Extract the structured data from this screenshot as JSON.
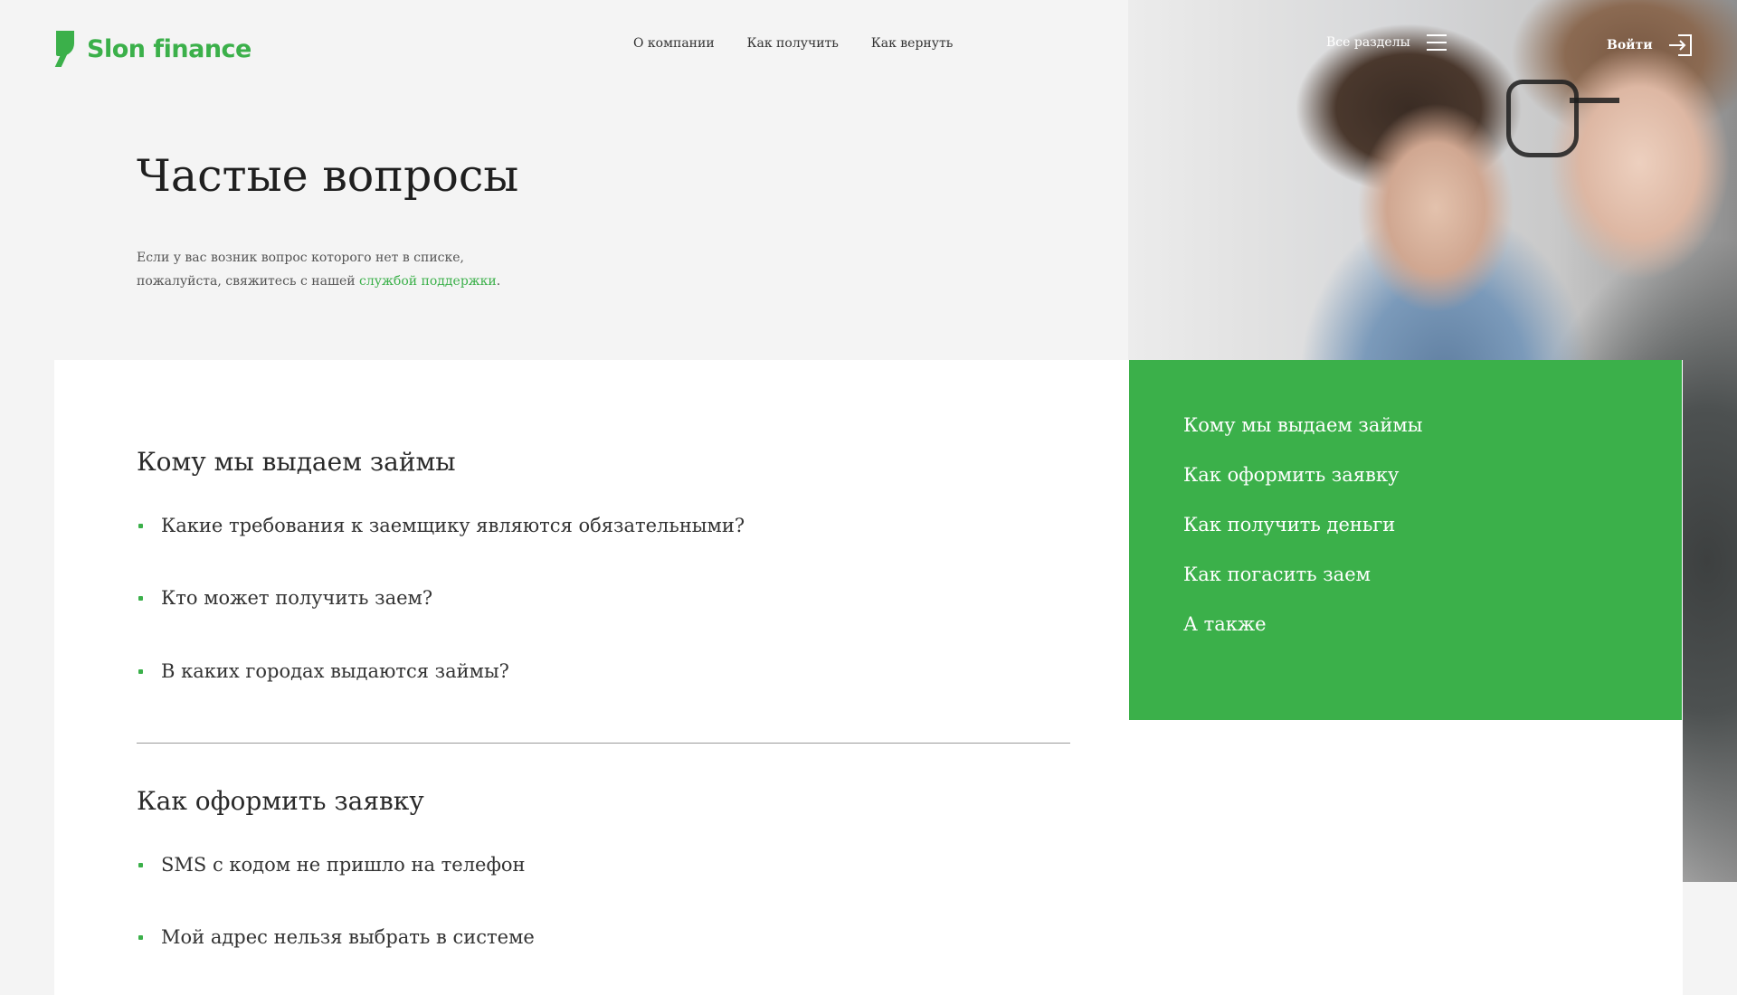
{
  "brand": {
    "name": "Slon finance",
    "color": "#3bb04a"
  },
  "topnav": [
    "О компании",
    "Как получить",
    "Как вернуть"
  ],
  "header": {
    "sections_label": "Все разделы",
    "login_label": "Войти"
  },
  "hero": {
    "title": "Частые вопросы",
    "intro_line1": "Если у вас возник вопрос которого нет в списке,",
    "intro_line2": "пожалуйста, свяжитесь с нашей",
    "intro_link": "службой поддержки",
    "intro_end": "."
  },
  "faq_sections": [
    {
      "title": "Кому мы выдаем займы",
      "questions": [
        "Какие требования к заемщику являются обязательными?",
        "Кто может получить заем?",
        "В каких городах выдаются займы?"
      ]
    },
    {
      "title": "Как оформить заявку",
      "questions": [
        "SMS с кодом не пришло на телефон",
        "Мой адрес нельзя выбрать в системе"
      ]
    }
  ],
  "side_nav": [
    "Кому мы выдаем займы",
    "Как оформить заявку",
    "Как получить деньги",
    "Как погасить заем",
    "А также"
  ]
}
